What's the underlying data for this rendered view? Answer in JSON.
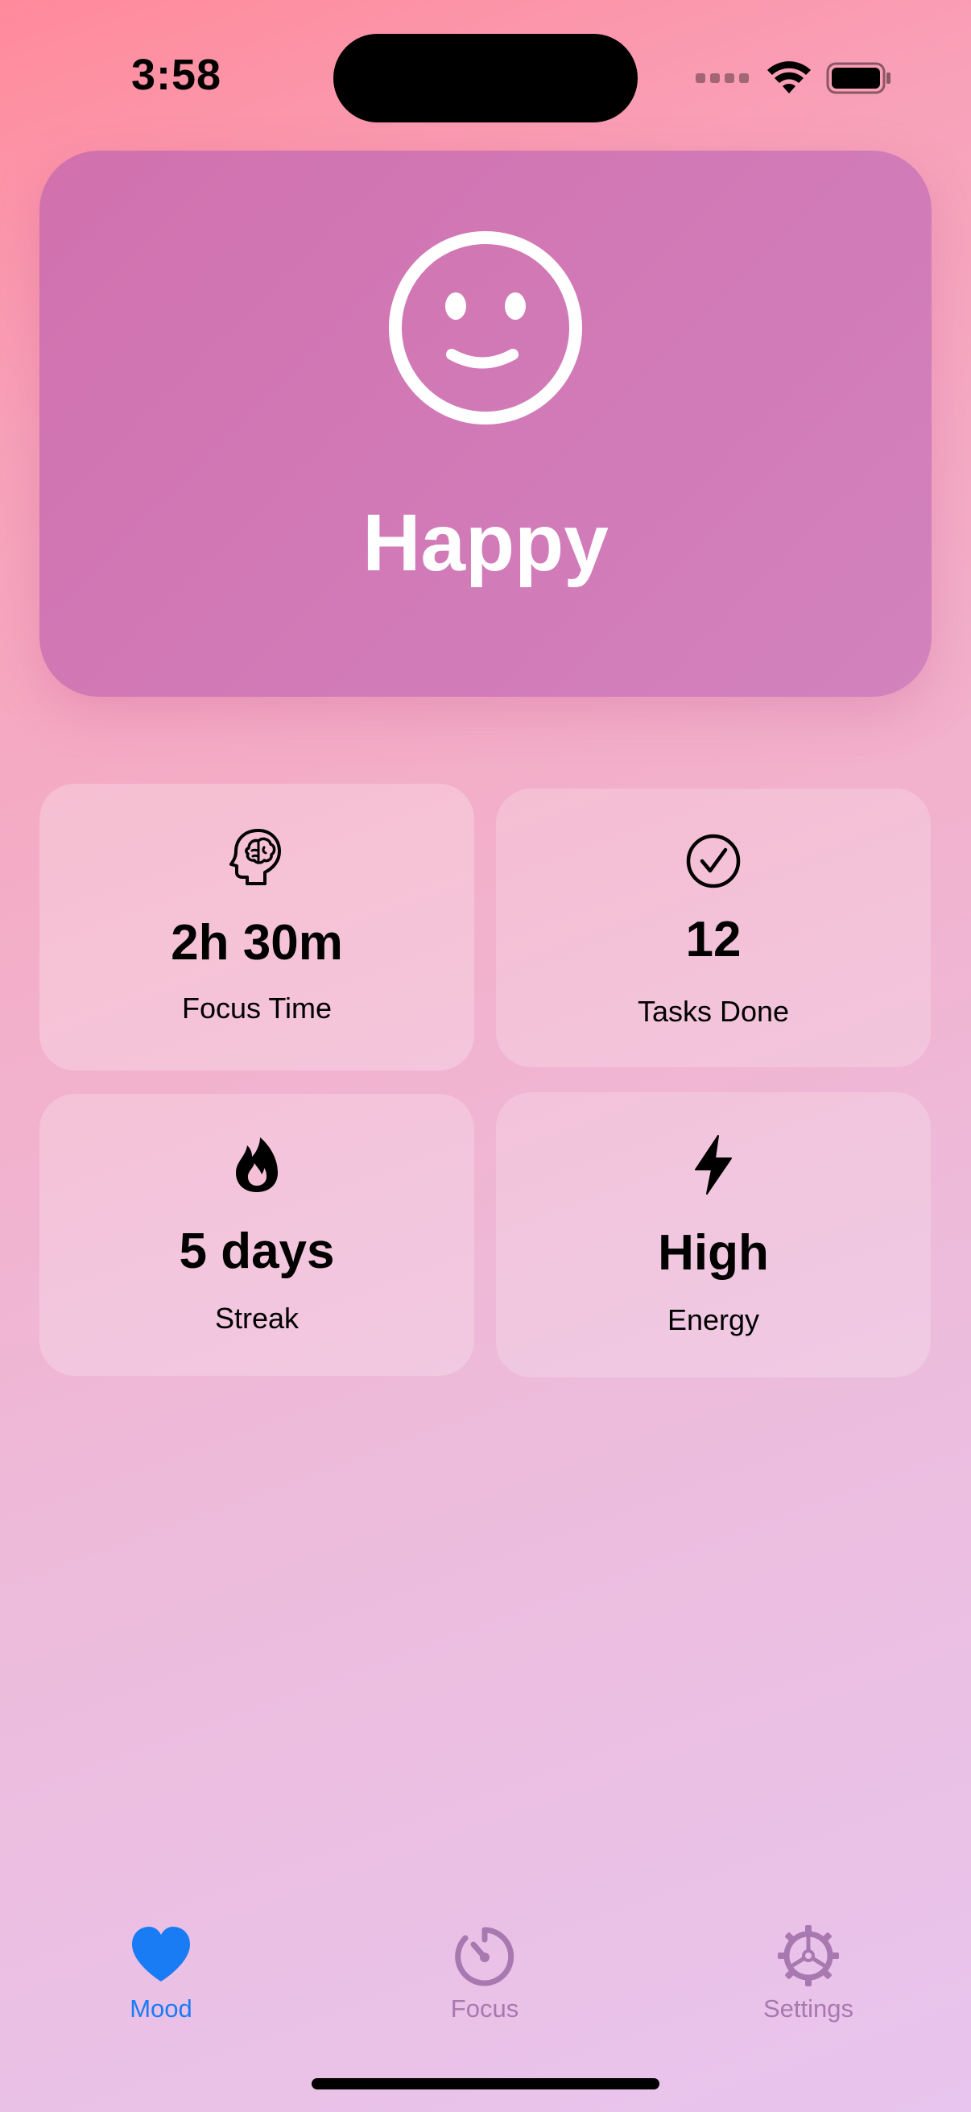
{
  "status_bar": {
    "time": "3:58"
  },
  "mood_card": {
    "icon": "smiley-face-icon",
    "mood": "Happy"
  },
  "stats": [
    {
      "icon": "brain-head-icon",
      "value": "2h 30m",
      "label": "Focus Time"
    },
    {
      "icon": "checkmark-circle-icon",
      "value": "12",
      "label": "Tasks Done"
    },
    {
      "icon": "flame-icon",
      "value": "5 days",
      "label": "Streak"
    },
    {
      "icon": "bolt-icon",
      "value": "High",
      "label": "Energy"
    }
  ],
  "tab_bar": {
    "tabs": [
      {
        "label": "Mood",
        "icon": "heart-icon",
        "selected": true
      },
      {
        "label": "Focus",
        "icon": "timer-icon",
        "selected": false
      },
      {
        "label": "Settings",
        "icon": "gear-icon",
        "selected": false
      }
    ]
  },
  "colors": {
    "accent": "#1A7CF5",
    "tab_inactive": "#A879B0",
    "mood_card": "#D17AB6"
  }
}
